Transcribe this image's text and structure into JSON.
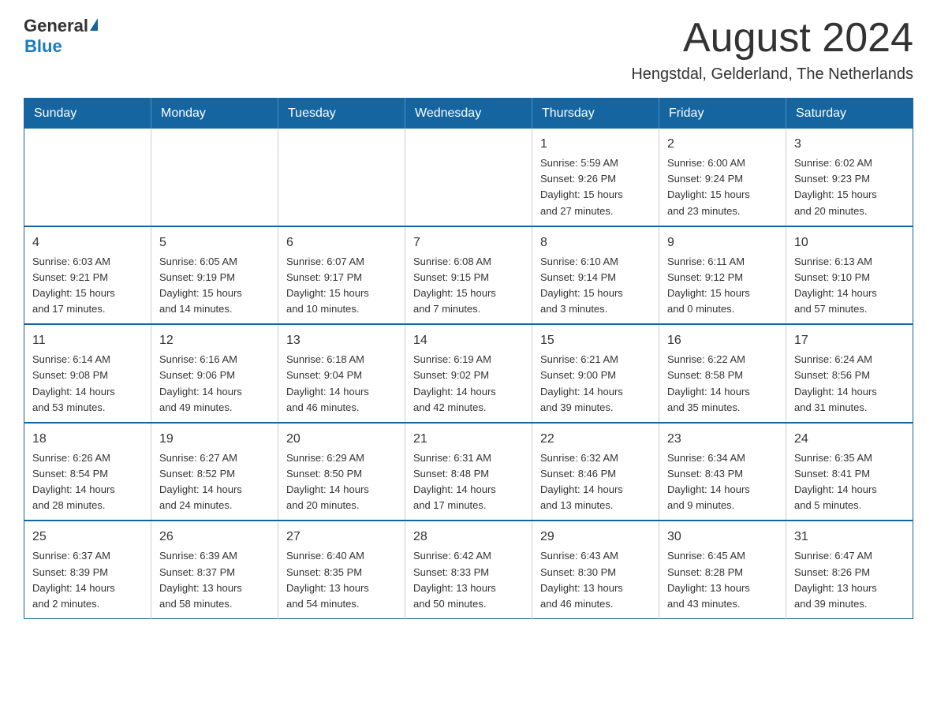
{
  "header": {
    "logo_general": "General",
    "logo_blue": "Blue",
    "month_title": "August 2024",
    "location": "Hengstdal, Gelderland, The Netherlands"
  },
  "days_of_week": [
    "Sunday",
    "Monday",
    "Tuesday",
    "Wednesday",
    "Thursday",
    "Friday",
    "Saturday"
  ],
  "weeks": [
    [
      {
        "day": "",
        "info": ""
      },
      {
        "day": "",
        "info": ""
      },
      {
        "day": "",
        "info": ""
      },
      {
        "day": "",
        "info": ""
      },
      {
        "day": "1",
        "info": "Sunrise: 5:59 AM\nSunset: 9:26 PM\nDaylight: 15 hours\nand 27 minutes."
      },
      {
        "day": "2",
        "info": "Sunrise: 6:00 AM\nSunset: 9:24 PM\nDaylight: 15 hours\nand 23 minutes."
      },
      {
        "day": "3",
        "info": "Sunrise: 6:02 AM\nSunset: 9:23 PM\nDaylight: 15 hours\nand 20 minutes."
      }
    ],
    [
      {
        "day": "4",
        "info": "Sunrise: 6:03 AM\nSunset: 9:21 PM\nDaylight: 15 hours\nand 17 minutes."
      },
      {
        "day": "5",
        "info": "Sunrise: 6:05 AM\nSunset: 9:19 PM\nDaylight: 15 hours\nand 14 minutes."
      },
      {
        "day": "6",
        "info": "Sunrise: 6:07 AM\nSunset: 9:17 PM\nDaylight: 15 hours\nand 10 minutes."
      },
      {
        "day": "7",
        "info": "Sunrise: 6:08 AM\nSunset: 9:15 PM\nDaylight: 15 hours\nand 7 minutes."
      },
      {
        "day": "8",
        "info": "Sunrise: 6:10 AM\nSunset: 9:14 PM\nDaylight: 15 hours\nand 3 minutes."
      },
      {
        "day": "9",
        "info": "Sunrise: 6:11 AM\nSunset: 9:12 PM\nDaylight: 15 hours\nand 0 minutes."
      },
      {
        "day": "10",
        "info": "Sunrise: 6:13 AM\nSunset: 9:10 PM\nDaylight: 14 hours\nand 57 minutes."
      }
    ],
    [
      {
        "day": "11",
        "info": "Sunrise: 6:14 AM\nSunset: 9:08 PM\nDaylight: 14 hours\nand 53 minutes."
      },
      {
        "day": "12",
        "info": "Sunrise: 6:16 AM\nSunset: 9:06 PM\nDaylight: 14 hours\nand 49 minutes."
      },
      {
        "day": "13",
        "info": "Sunrise: 6:18 AM\nSunset: 9:04 PM\nDaylight: 14 hours\nand 46 minutes."
      },
      {
        "day": "14",
        "info": "Sunrise: 6:19 AM\nSunset: 9:02 PM\nDaylight: 14 hours\nand 42 minutes."
      },
      {
        "day": "15",
        "info": "Sunrise: 6:21 AM\nSunset: 9:00 PM\nDaylight: 14 hours\nand 39 minutes."
      },
      {
        "day": "16",
        "info": "Sunrise: 6:22 AM\nSunset: 8:58 PM\nDaylight: 14 hours\nand 35 minutes."
      },
      {
        "day": "17",
        "info": "Sunrise: 6:24 AM\nSunset: 8:56 PM\nDaylight: 14 hours\nand 31 minutes."
      }
    ],
    [
      {
        "day": "18",
        "info": "Sunrise: 6:26 AM\nSunset: 8:54 PM\nDaylight: 14 hours\nand 28 minutes."
      },
      {
        "day": "19",
        "info": "Sunrise: 6:27 AM\nSunset: 8:52 PM\nDaylight: 14 hours\nand 24 minutes."
      },
      {
        "day": "20",
        "info": "Sunrise: 6:29 AM\nSunset: 8:50 PM\nDaylight: 14 hours\nand 20 minutes."
      },
      {
        "day": "21",
        "info": "Sunrise: 6:31 AM\nSunset: 8:48 PM\nDaylight: 14 hours\nand 17 minutes."
      },
      {
        "day": "22",
        "info": "Sunrise: 6:32 AM\nSunset: 8:46 PM\nDaylight: 14 hours\nand 13 minutes."
      },
      {
        "day": "23",
        "info": "Sunrise: 6:34 AM\nSunset: 8:43 PM\nDaylight: 14 hours\nand 9 minutes."
      },
      {
        "day": "24",
        "info": "Sunrise: 6:35 AM\nSunset: 8:41 PM\nDaylight: 14 hours\nand 5 minutes."
      }
    ],
    [
      {
        "day": "25",
        "info": "Sunrise: 6:37 AM\nSunset: 8:39 PM\nDaylight: 14 hours\nand 2 minutes."
      },
      {
        "day": "26",
        "info": "Sunrise: 6:39 AM\nSunset: 8:37 PM\nDaylight: 13 hours\nand 58 minutes."
      },
      {
        "day": "27",
        "info": "Sunrise: 6:40 AM\nSunset: 8:35 PM\nDaylight: 13 hours\nand 54 minutes."
      },
      {
        "day": "28",
        "info": "Sunrise: 6:42 AM\nSunset: 8:33 PM\nDaylight: 13 hours\nand 50 minutes."
      },
      {
        "day": "29",
        "info": "Sunrise: 6:43 AM\nSunset: 8:30 PM\nDaylight: 13 hours\nand 46 minutes."
      },
      {
        "day": "30",
        "info": "Sunrise: 6:45 AM\nSunset: 8:28 PM\nDaylight: 13 hours\nand 43 minutes."
      },
      {
        "day": "31",
        "info": "Sunrise: 6:47 AM\nSunset: 8:26 PM\nDaylight: 13 hours\nand 39 minutes."
      }
    ]
  ]
}
